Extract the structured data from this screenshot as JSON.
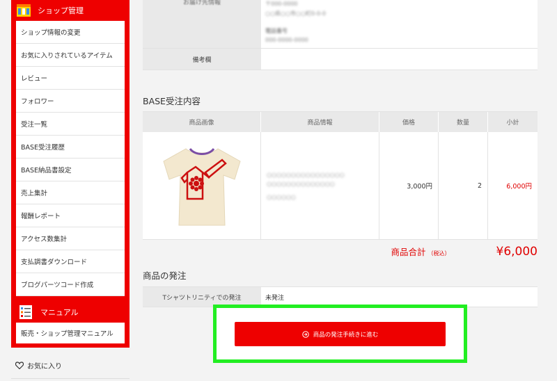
{
  "sidebar": {
    "shop_section_title": "ショップ管理",
    "shop_items": [
      {
        "label": "ショップ情報の変更"
      },
      {
        "label": "お気に入りされているアイテム"
      },
      {
        "label": "レビュー"
      },
      {
        "label": "フォロワー"
      },
      {
        "label": "受注一覧"
      },
      {
        "label": "BASE受注履歴"
      },
      {
        "label": "BASE納品書設定"
      },
      {
        "label": "売上集計"
      },
      {
        "label": "報酬レポート"
      },
      {
        "label": "アクセス数集計"
      },
      {
        "label": "支払調書ダウンロード"
      },
      {
        "label": "ブログパーツコード作成"
      }
    ],
    "manual_section_title": "マニュアル",
    "manual_items": [
      {
        "label": "販売・ショップ管理マニュアル"
      }
    ],
    "favorites_label": "お気に入り"
  },
  "shipping_info": {
    "destination_label": "お届け先情報",
    "destination_value_line1": "〒000-0000",
    "destination_value_line2": "○○県○○市○○町0-0-0",
    "phone_label": "電話番号",
    "phone_value": "000-0000-0000",
    "notes_label": "備考欄",
    "notes_value": ""
  },
  "base_order": {
    "title": "BASE受注内容",
    "columns": [
      "商品画像",
      "商品情報",
      "価格",
      "数量",
      "小計"
    ],
    "item": {
      "info_line1": "○○○○○○○○○○○○○○○○",
      "info_line2": "○○○○○○○○○○○○○○",
      "info_line3": "○○○○○○",
      "price": "3,000円",
      "quantity": "2",
      "subtotal": "6,000円"
    },
    "total_label": "商品合計",
    "total_tax_note": "（税込）",
    "total_amount": "¥6,000"
  },
  "shipment": {
    "title": "商品の発注",
    "provider_label": "Tシャツトリニティでの発注",
    "status": "未発注",
    "button_label": "商品の発注手続きに進む"
  },
  "colors": {
    "brand_red": "#ee0000",
    "highlight_green": "#22ee22"
  }
}
